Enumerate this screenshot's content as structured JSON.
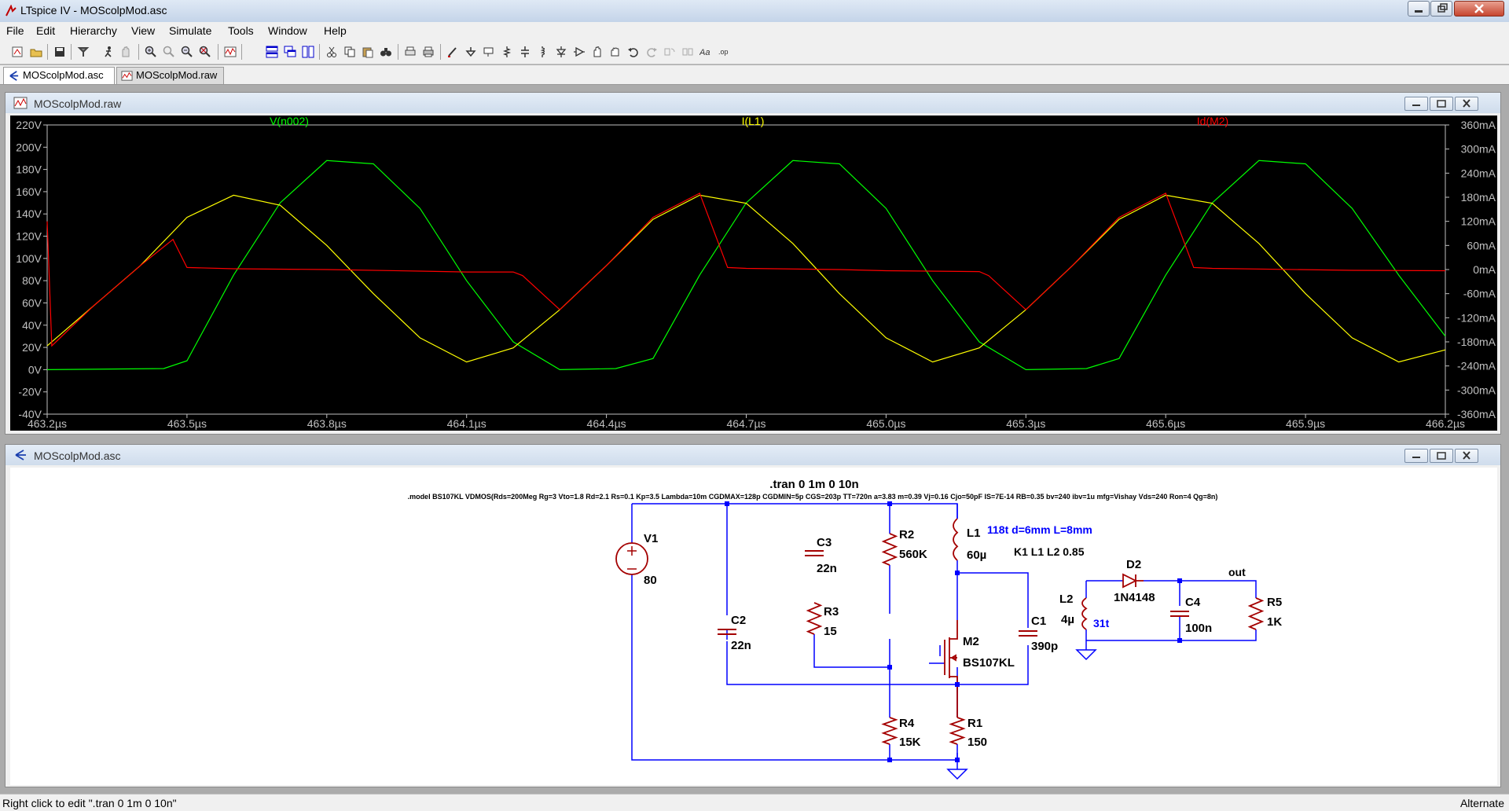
{
  "window": {
    "title": "LTspice IV - MOScolpMod.asc"
  },
  "menu": [
    "File",
    "Edit",
    "Hierarchy",
    "View",
    "Simulate",
    "Tools",
    "Window",
    "Help"
  ],
  "tabs": [
    {
      "label": "MOScolpMod.asc",
      "active": true
    },
    {
      "label": "MOScolpMod.raw",
      "active": false
    }
  ],
  "plot_window": {
    "title": "MOScolpMod.raw",
    "traces": [
      {
        "name": "V(n002)",
        "color": "#00FF00"
      },
      {
        "name": "I(L1)",
        "color": "#FFFF00"
      },
      {
        "name": "Id(M2)",
        "color": "#FF0000"
      }
    ],
    "left_axis": [
      "220V",
      "200V",
      "180V",
      "160V",
      "140V",
      "120V",
      "100V",
      "80V",
      "60V",
      "40V",
      "20V",
      "0V",
      "-20V",
      "-40V"
    ],
    "right_axis": [
      "360mA",
      "300mA",
      "240mA",
      "180mA",
      "120mA",
      "60mA",
      "0mA",
      "-60mA",
      "-120mA",
      "-180mA",
      "-240mA",
      "-300mA",
      "-360mA"
    ],
    "x_axis": [
      "463.2µs",
      "463.5µs",
      "463.8µs",
      "464.1µs",
      "464.4µs",
      "464.7µs",
      "465.0µs",
      "465.3µs",
      "465.6µs",
      "465.9µs",
      "466.2µs"
    ]
  },
  "chart_data": {
    "type": "line",
    "xlim": [
      463.2,
      466.2
    ],
    "xunit": "µs",
    "ylim_left": [
      -40,
      220
    ],
    "ylim_right": [
      -360,
      360
    ],
    "series": [
      {
        "name": "V(n002)",
        "color": "#00FF00",
        "axis": "left",
        "x": [
          463.2,
          463.45,
          463.5,
          463.6,
          463.7,
          463.8,
          463.9,
          464.0,
          464.1,
          464.2,
          464.3,
          464.42,
          464.5,
          464.6,
          464.7,
          464.8,
          464.9,
          465.0,
          465.1,
          465.2,
          465.3,
          465.43,
          465.5,
          465.6,
          465.7,
          465.8,
          465.9,
          466.0,
          466.1,
          466.2
        ],
        "y": [
          0,
          1,
          8,
          85,
          150,
          188,
          185,
          145,
          80,
          25,
          0,
          1,
          10,
          85,
          150,
          188,
          185,
          145,
          80,
          25,
          0,
          1,
          10,
          85,
          150,
          188,
          185,
          145,
          85,
          30
        ]
      },
      {
        "name": "I(L1)",
        "color": "#FFFF00",
        "axis": "right",
        "x": [
          463.2,
          463.3,
          463.4,
          463.5,
          463.6,
          463.7,
          463.8,
          463.9,
          464.0,
          464.1,
          464.2,
          464.3,
          464.4,
          464.5,
          464.6,
          464.7,
          464.8,
          464.9,
          465.0,
          465.1,
          465.2,
          465.3,
          465.4,
          465.5,
          465.6,
          465.7,
          465.8,
          465.9,
          466.0,
          466.1,
          466.2
        ],
        "y": [
          -190,
          -90,
          10,
          130,
          185,
          160,
          60,
          -60,
          -170,
          -230,
          -195,
          -100,
          10,
          125,
          185,
          165,
          65,
          -60,
          -170,
          -230,
          -195,
          -100,
          10,
          125,
          185,
          165,
          65,
          -60,
          -170,
          -230,
          -200
        ]
      },
      {
        "name": "Id(M2)",
        "color": "#FF0000",
        "axis": "right",
        "x": [
          463.2,
          463.21,
          463.3,
          463.4,
          463.47,
          463.5,
          463.6,
          463.8,
          464.0,
          464.1,
          464.2,
          464.22,
          464.3,
          464.4,
          464.5,
          464.6,
          464.66,
          464.7,
          464.9,
          465.0,
          465.2,
          465.22,
          465.3,
          465.4,
          465.5,
          465.6,
          465.66,
          465.7,
          466.0,
          466.2
        ],
        "y": [
          120,
          -190,
          -90,
          10,
          75,
          5,
          2,
          0,
          -4,
          -6,
          -6,
          -15,
          -100,
          10,
          130,
          190,
          5,
          3,
          0,
          -3,
          -5,
          -15,
          -100,
          10,
          130,
          190,
          5,
          3,
          -2,
          -3
        ]
      }
    ]
  },
  "schematic_window": {
    "title": "MOScolpMod.asc",
    "directive": ".tran 0 1m 0 10n",
    "model": ".model BS107KL VDMOS(Rds=200Meg Rg=3 Vto=1.8 Rd=2.1 Rs=0.1 Kp=3.5 Lambda=10m CGDMAX=128p CGDMIN=5p CGS=203p TT=720n a=3.83 m=0.39 Vj=0.16 Cjo=50pF IS=7E-14 RB=0.35 bv=240 ibv=1u mfg=Vishay Vds=240 Ron=4 Qg=8n)",
    "components": {
      "V1": {
        "name": "V1",
        "value": "80"
      },
      "C2": {
        "name": "C2",
        "value": "22n"
      },
      "C3": {
        "name": "C3",
        "value": "22n"
      },
      "R3": {
        "name": "R3",
        "value": "15"
      },
      "R2": {
        "name": "R2",
        "value": "560K"
      },
      "L1": {
        "name": "L1",
        "value": "60µ"
      },
      "M2": {
        "name": "M2",
        "value": "BS107KL"
      },
      "C1": {
        "name": "C1",
        "value": "390p"
      },
      "R4": {
        "name": "R4",
        "value": "15K"
      },
      "R1": {
        "name": "R1",
        "value": "150"
      },
      "L2": {
        "name": "L2",
        "value": "4µ"
      },
      "D2": {
        "name": "D2",
        "value": "1N4148"
      },
      "C4": {
        "name": "C4",
        "value": "100n"
      },
      "R5": {
        "name": "R5",
        "value": "1K"
      }
    },
    "l1_comment": "118t d=6mm L=8mm",
    "coupling": "K1 L1 L2 0.85",
    "l2_comment": "31t",
    "net_out": "out"
  },
  "status": {
    "left": "Right click to edit \".tran 0 1m 0 10n\"",
    "right": "Alternate"
  }
}
